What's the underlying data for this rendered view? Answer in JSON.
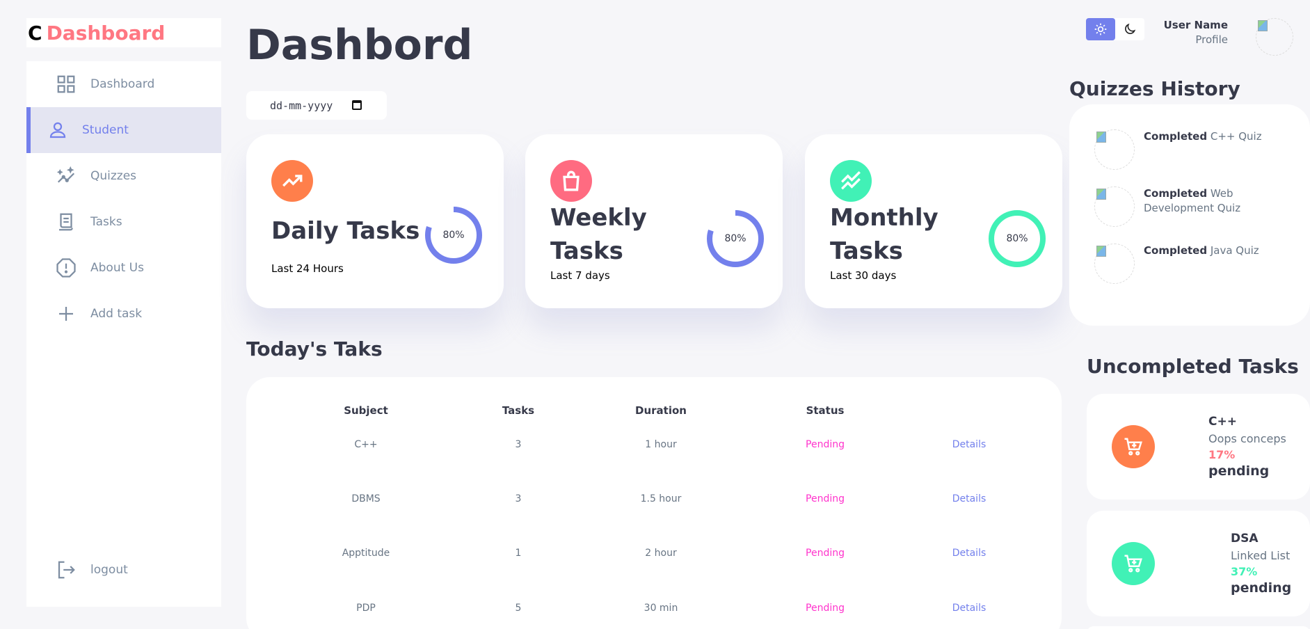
{
  "brand": {
    "letter": "C",
    "name": "Dashboard"
  },
  "sidebar": {
    "items": [
      {
        "label": "Dashboard",
        "icon": "grid-icon",
        "active": false
      },
      {
        "label": "Student",
        "icon": "person-icon",
        "active": true
      },
      {
        "label": "Quizzes",
        "icon": "insights-icon",
        "active": false
      },
      {
        "label": "Tasks",
        "icon": "receipt-icon",
        "active": false
      },
      {
        "label": "About Us",
        "icon": "info-icon",
        "active": false
      },
      {
        "label": "Add task",
        "icon": "plus-icon",
        "active": false
      }
    ],
    "logout": "logout"
  },
  "header": {
    "title": "Dashbord"
  },
  "date_input": {
    "placeholder": "dd-mm-yyyy"
  },
  "cards": [
    {
      "title": "Daily Tasks",
      "subtitle": "Last 24 Hours",
      "percent": 80,
      "percent_label": "80%",
      "icon": "trending-up-icon",
      "color": "#ff7f4b",
      "ring_color": "#7380ec"
    },
    {
      "title": "Weekly Tasks",
      "subtitle": "Last 7 days",
      "percent": 80,
      "percent_label": "80%",
      "icon": "shopping-bag-icon",
      "color": "#ff6b81",
      "ring_color": "#7380ec"
    },
    {
      "title": "Monthly Tasks",
      "subtitle": "Last 30 days",
      "percent": 100,
      "percent_label": "80%",
      "icon": "stacked-line-icon",
      "color": "#41f1b6",
      "ring_color": "#41f1b6"
    }
  ],
  "todays_tasks": {
    "title": "Today's Taks",
    "columns": [
      "Subject",
      "Tasks",
      "Duration",
      "Status"
    ],
    "rows": [
      {
        "subject": "C++",
        "tasks": "3",
        "duration": "1 hour",
        "status": "Pending",
        "action": "Details"
      },
      {
        "subject": "DBMS",
        "tasks": "3",
        "duration": "1.5 hour",
        "status": "Pending",
        "action": "Details"
      },
      {
        "subject": "Apptitude",
        "tasks": "1",
        "duration": "2 hour",
        "status": "Pending",
        "action": "Details"
      },
      {
        "subject": "PDP",
        "tasks": "5",
        "duration": "30 min",
        "status": "Pending",
        "action": "Details"
      }
    ]
  },
  "theme_toggle": {
    "light_icon": "sun-icon",
    "dark_icon": "moon-icon",
    "active": "light"
  },
  "user": {
    "name": "User Name",
    "role": "Profile"
  },
  "quizzes_history": {
    "title": "Quizzes History",
    "items": [
      {
        "status": "Completed",
        "quiz": "C++ Quiz"
      },
      {
        "status": "Completed",
        "quiz": "Web Development Quiz"
      },
      {
        "status": "Completed",
        "quiz": "Java Quiz"
      }
    ]
  },
  "uncompleted_tasks": {
    "title": "Uncompleted Tasks",
    "items": [
      {
        "subject": "C++",
        "topic": "Oops conceps",
        "percent": "17%",
        "status": "pending",
        "icon": "cart-icon",
        "color": "#ff7f4b",
        "pct_color": "#ff7782"
      },
      {
        "subject": "DSA",
        "topic": "Linked List",
        "percent": "37%",
        "status": "pending",
        "icon": "cart-icon",
        "color": "#41f1b6",
        "pct_color": "#41f1b6"
      }
    ]
  }
}
